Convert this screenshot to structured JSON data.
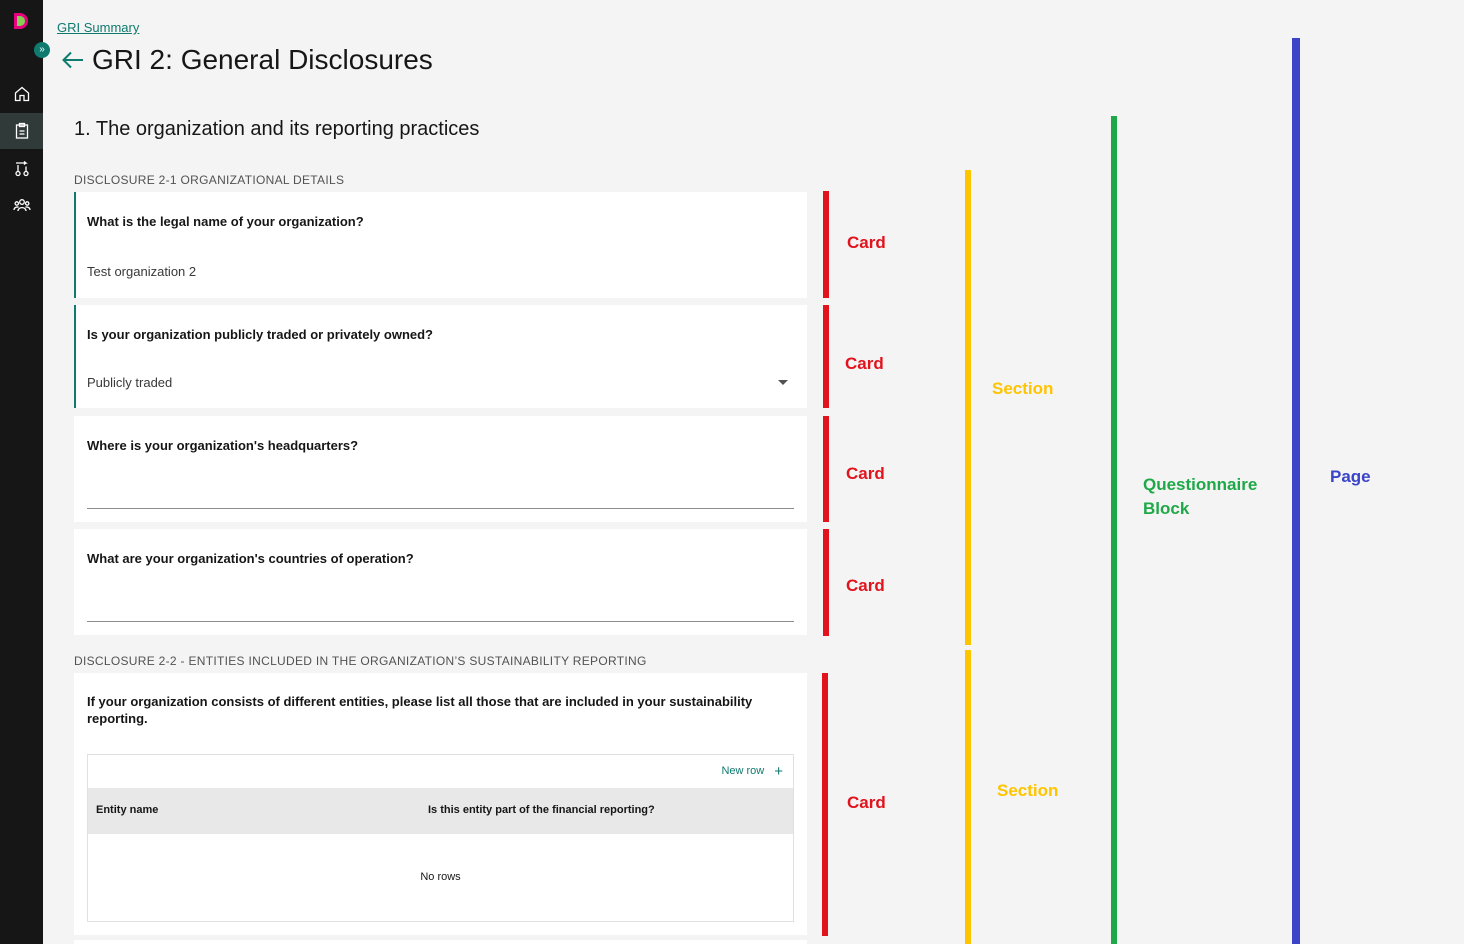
{
  "colors": {
    "rail_bg": "#161616",
    "accent_teal": "#0f7a6e",
    "card_annotation": "#e1141e",
    "section_annotation": "#ffc400",
    "block_annotation": "#1fa848",
    "page_annotation": "#3b44c8"
  },
  "rail": {
    "expand_icon": "chevron-double-right-icon",
    "items": [
      {
        "icon": "home-icon"
      },
      {
        "icon": "clipboard-icon",
        "active": true
      },
      {
        "icon": "workflow-icon"
      },
      {
        "icon": "users-icon"
      }
    ]
  },
  "header": {
    "breadcrumb": "GRI Summary",
    "title": "GRI 2: General Disclosures"
  },
  "section": {
    "heading": "1. The organization and its reporting practices"
  },
  "disclosures": [
    {
      "label": "DISCLOSURE 2-1 ORGANIZATIONAL DETAILS",
      "questions": [
        {
          "question": "What is the legal name of your organization?",
          "answer": "Test organization 2"
        },
        {
          "question": "Is your organization publicly traded or privately owned?",
          "answer": "Publicly traded"
        },
        {
          "question": "Where is your organization's headquarters?",
          "answer": ""
        },
        {
          "question": "What are your organization's countries of operation?",
          "answer": ""
        }
      ]
    },
    {
      "label": "DISCLOSURE 2-2 - ENTITIES INCLUDED IN THE ORGANIZATION’S SUSTAINABILITY REPORTING",
      "questions": [
        {
          "question": "If your organization consists of different entities, please list all those that are included in your sustainability reporting.",
          "table": {
            "new_row_label": "New row",
            "columns": [
              "Entity name",
              "Is this entity part of the financial reporting?"
            ],
            "empty_text": "No rows"
          }
        }
      ]
    }
  ],
  "annotations": {
    "card": "Card",
    "section": "Section",
    "questionnaire_block": "Questionnaire Block",
    "page": "Page"
  }
}
